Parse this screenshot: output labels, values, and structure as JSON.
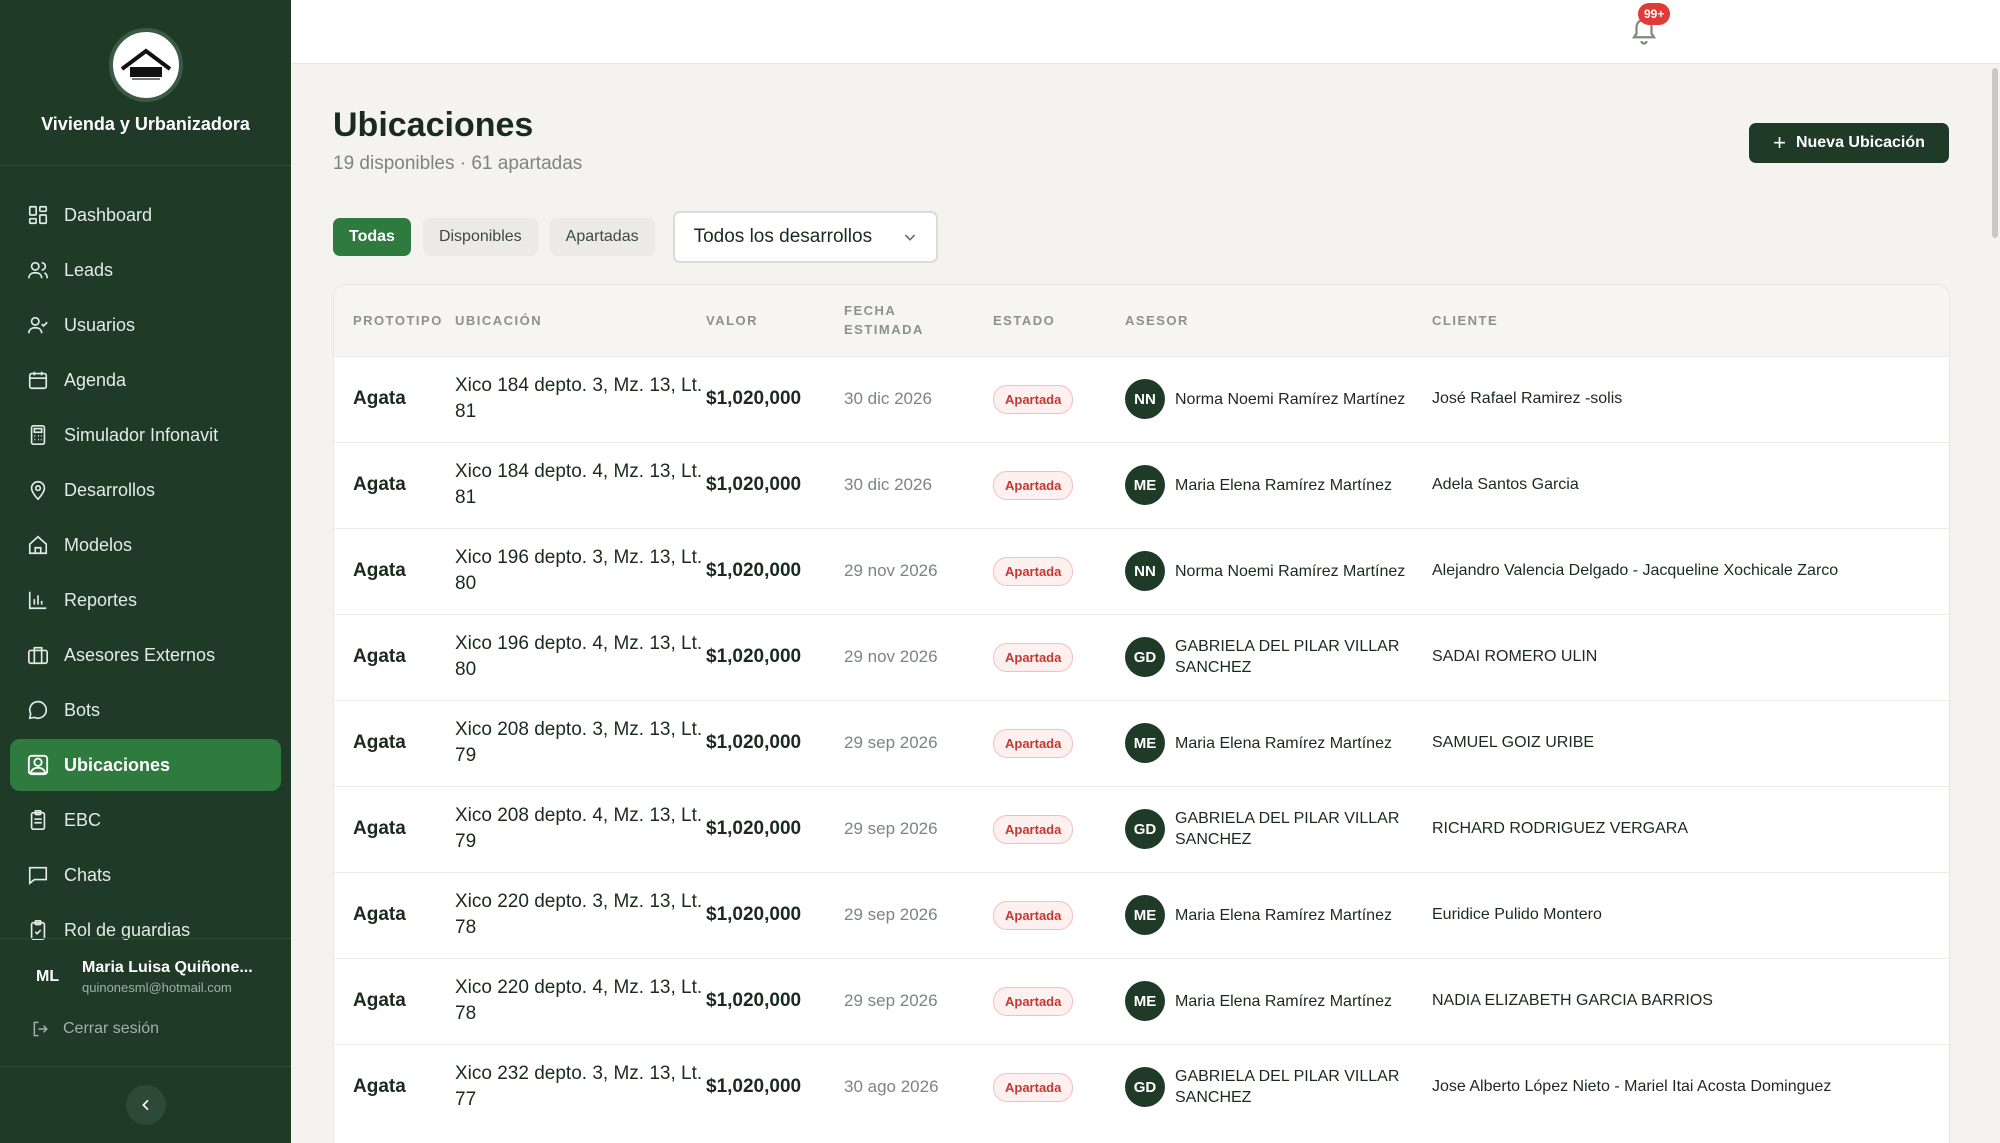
{
  "brand": {
    "name": "Vivienda y Urbanizadora"
  },
  "nav": [
    {
      "label": "Dashboard",
      "icon": "dashboard-icon"
    },
    {
      "label": "Leads",
      "icon": "users-icon"
    },
    {
      "label": "Usuarios",
      "icon": "user-check-icon"
    },
    {
      "label": "Agenda",
      "icon": "calendar-icon"
    },
    {
      "label": "Simulador Infonavit",
      "icon": "calculator-icon"
    },
    {
      "label": "Desarrollos",
      "icon": "map-pin-icon"
    },
    {
      "label": "Modelos",
      "icon": "home-icon"
    },
    {
      "label": "Reportes",
      "icon": "bar-chart-icon"
    },
    {
      "label": "Asesores Externos",
      "icon": "briefcase-icon"
    },
    {
      "label": "Bots",
      "icon": "message-circle-icon"
    },
    {
      "label": "Ubicaciones",
      "icon": "location-user-icon",
      "active": true
    },
    {
      "label": "EBC",
      "icon": "clipboard-icon"
    },
    {
      "label": "Chats",
      "icon": "message-square-icon"
    },
    {
      "label": "Rol de guardias",
      "icon": "clipboard-check-icon"
    }
  ],
  "user": {
    "initials": "ML",
    "name": "Maria Luisa Quiñone...",
    "email": "quinonesml@hotmail.com",
    "logout_label": "Cerrar sesión"
  },
  "notifications": {
    "badge": "99+"
  },
  "page": {
    "title": "Ubicaciones",
    "subtitle": "19 disponibles · 61 apartadas",
    "new_button": "Nueva Ubicación"
  },
  "filters": {
    "chips": [
      "Todas",
      "Disponibles",
      "Apartadas"
    ],
    "active_chip": "Todas",
    "development_select": "Todos los desarrollos"
  },
  "table": {
    "headers": {
      "prototipo": "PROTOTIPO",
      "ubicacion": "UBICACIÓN",
      "valor": "VALOR",
      "fecha_line1": "FECHA",
      "fecha_line2": "ESTIMADA",
      "estado": "ESTADO",
      "asesor": "ASESOR",
      "cliente": "CLIENTE"
    },
    "rows": [
      {
        "prototipo": "Agata",
        "ubicacion": "Xico 184 depto. 3, Mz. 13, Lt. 81",
        "valor": "$1,020,000",
        "fecha": "30 dic 2026",
        "estado": "Apartada",
        "asesor_initials": "NN",
        "asesor": "Norma Noemi Ramírez Martínez",
        "cliente": "José Rafael Ramirez -solis"
      },
      {
        "prototipo": "Agata",
        "ubicacion": "Xico 184 depto. 4, Mz. 13, Lt. 81",
        "valor": "$1,020,000",
        "fecha": "30 dic 2026",
        "estado": "Apartada",
        "asesor_initials": "ME",
        "asesor": "Maria Elena Ramírez Martínez",
        "cliente": "Adela Santos Garcia"
      },
      {
        "prototipo": "Agata",
        "ubicacion": "Xico 196 depto. 3, Mz. 13, Lt. 80",
        "valor": "$1,020,000",
        "fecha": "29 nov 2026",
        "estado": "Apartada",
        "asesor_initials": "NN",
        "asesor": "Norma Noemi Ramírez Martínez",
        "cliente": "Alejandro Valencia Delgado - Jacqueline Xochicale Zarco"
      },
      {
        "prototipo": "Agata",
        "ubicacion": "Xico 196 depto. 4, Mz. 13, Lt. 80",
        "valor": "$1,020,000",
        "fecha": "29 nov 2026",
        "estado": "Apartada",
        "asesor_initials": "GD",
        "asesor": "GABRIELA DEL PILAR VILLAR SANCHEZ",
        "cliente": "SADAI ROMERO ULIN"
      },
      {
        "prototipo": "Agata",
        "ubicacion": "Xico 208 depto. 3, Mz. 13, Lt. 79",
        "valor": "$1,020,000",
        "fecha": "29 sep 2026",
        "estado": "Apartada",
        "asesor_initials": "ME",
        "asesor": "Maria Elena Ramírez Martínez",
        "cliente": "SAMUEL GOIZ URIBE"
      },
      {
        "prototipo": "Agata",
        "ubicacion": "Xico 208 depto. 4, Mz. 13, Lt. 79",
        "valor": "$1,020,000",
        "fecha": "29 sep 2026",
        "estado": "Apartada",
        "asesor_initials": "GD",
        "asesor": "GABRIELA DEL PILAR VILLAR SANCHEZ",
        "cliente": "RICHARD RODRIGUEZ VERGARA"
      },
      {
        "prototipo": "Agata",
        "ubicacion": "Xico 220 depto. 3, Mz. 13, Lt. 78",
        "valor": "$1,020,000",
        "fecha": "29 sep 2026",
        "estado": "Apartada",
        "asesor_initials": "ME",
        "asesor": "Maria Elena Ramírez Martínez",
        "cliente": "Euridice Pulido Montero"
      },
      {
        "prototipo": "Agata",
        "ubicacion": "Xico 220 depto. 4, Mz. 13, Lt. 78",
        "valor": "$1,020,000",
        "fecha": "29 sep 2026",
        "estado": "Apartada",
        "asesor_initials": "ME",
        "asesor": "Maria Elena Ramírez Martínez",
        "cliente": "NADIA ELIZABETH GARCIA BARRIOS"
      },
      {
        "prototipo": "Agata",
        "ubicacion": "Xico 232 depto. 3, Mz. 13, Lt. 77",
        "valor": "$1,020,000",
        "fecha": "30 ago 2026",
        "estado": "Apartada",
        "asesor_initials": "GD",
        "asesor": "GABRIELA DEL PILAR VILLAR SANCHEZ",
        "cliente": "Jose Alberto López Nieto - Mariel Itai Acosta Dominguez"
      }
    ]
  },
  "colors": {
    "sidebar_bg": "#1f3a27",
    "accent_green": "#2f7a3f",
    "status_red": "#c03a34",
    "badge_red": "#e23a35"
  }
}
